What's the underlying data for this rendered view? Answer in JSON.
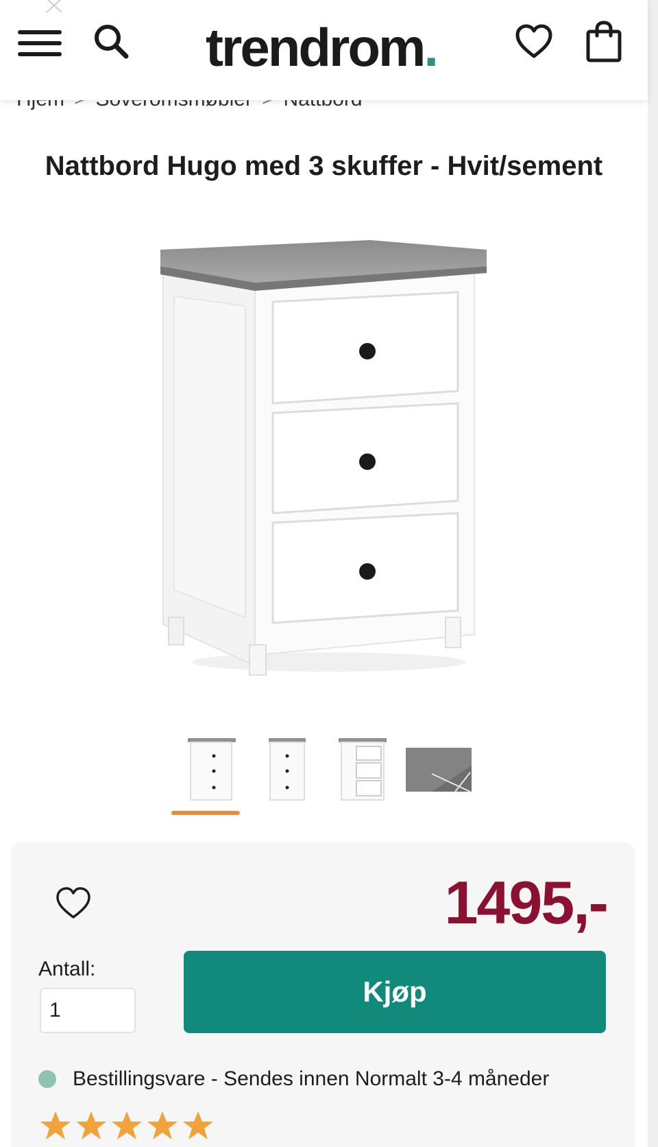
{
  "header": {
    "logo": "trendrom",
    "logo_dot": "."
  },
  "breadcrumb": {
    "items": [
      "Hjem",
      "Soveromsmøbler",
      "Nattbord"
    ],
    "separator": ">"
  },
  "product": {
    "title": "Nattbord Hugo med 3 skuffer - Hvit/sement",
    "price": "1495,-",
    "thumbnail_count": 4,
    "active_thumbnail_index": 0
  },
  "purchase": {
    "quantity_label": "Antall:",
    "quantity_value": "1",
    "buy_label": "Kjøp",
    "availability": "Bestillingsvare - Sendes innen Normalt 3-4 måneder"
  },
  "rating": {
    "stars": 5,
    "max": 5
  },
  "colors": {
    "price": "#8a1131",
    "buy_button": "#118a7c",
    "active_thumb_bar": "#e48f3f",
    "status_dot": "#8fc1b5",
    "star": "#f0a23b"
  },
  "icons": [
    "close-icon",
    "menu-icon",
    "search-icon",
    "heart-icon",
    "shopping-bag-icon",
    "star-icon"
  ]
}
